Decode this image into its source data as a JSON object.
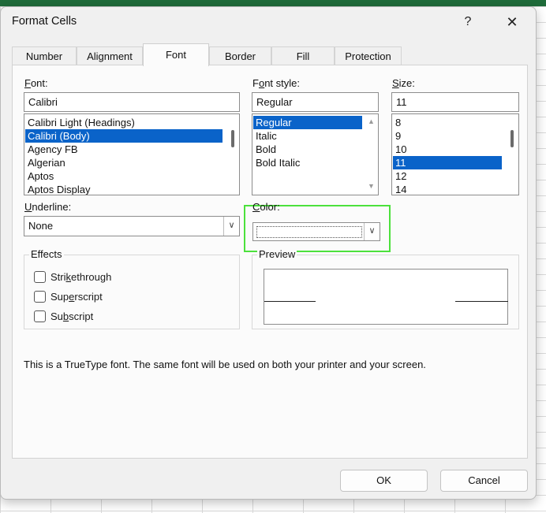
{
  "window": {
    "title": "Format Cells",
    "help": "?",
    "close": "✕"
  },
  "tabs": [
    "Number",
    "Alignment",
    "Font",
    "Border",
    "Fill",
    "Protection"
  ],
  "font": {
    "label_pre": "",
    "label_u": "F",
    "label_post": "ont:",
    "value": "Calibri",
    "items": [
      "Calibri Light (Headings)",
      "Calibri (Body)",
      "Agency FB",
      "Algerian",
      "Aptos",
      "Aptos Display"
    ],
    "selected_index": 1
  },
  "font_style": {
    "label_pre": "F",
    "label_u": "o",
    "label_post": "nt style:",
    "value": "Regular",
    "items": [
      "Regular",
      "Italic",
      "Bold",
      "Bold Italic"
    ],
    "selected_index": 0
  },
  "size": {
    "label_pre": "",
    "label_u": "S",
    "label_post": "ize:",
    "value": "11",
    "items": [
      "8",
      "9",
      "10",
      "11",
      "12",
      "14"
    ],
    "selected_index": 3
  },
  "underline": {
    "label_pre": "",
    "label_u": "U",
    "label_post": "nderline:",
    "value": "None"
  },
  "color": {
    "label_pre": "",
    "label_u": "C",
    "label_post": "olor:",
    "highlight_color": "#4ce13c"
  },
  "effects": {
    "title": "Effects",
    "items": [
      {
        "pre": "Stri",
        "u": "k",
        "post": "ethrough",
        "checked": false
      },
      {
        "pre": "Sup",
        "u": "e",
        "post": "rscript",
        "checked": false
      },
      {
        "pre": "Su",
        "u": "b",
        "post": "script",
        "checked": false
      }
    ]
  },
  "preview": {
    "title": "Preview"
  },
  "info_text": "This is a TrueType font.  The same font will be used on both your printer and your screen.",
  "buttons": {
    "ok": "OK",
    "cancel": "Cancel"
  },
  "colors": {
    "selection": "#0a63c9",
    "window_bg": "#f0f0f0",
    "panel_bg": "#fbfbfb"
  }
}
